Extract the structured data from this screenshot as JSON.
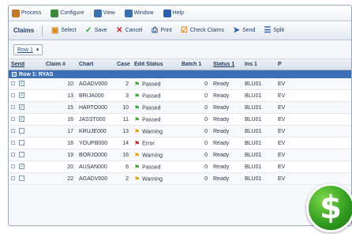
{
  "menubar": {
    "items": [
      {
        "label": "Process",
        "icon": "process-icon",
        "color": "#c47a2a"
      },
      {
        "label": "Configure",
        "icon": "configure-icon",
        "color": "#3d8a3d"
      },
      {
        "label": "View",
        "icon": "view-icon",
        "color": "#3a6fb0"
      },
      {
        "label": "Window",
        "icon": "window-icon",
        "color": "#3a6fb0"
      },
      {
        "label": "Help",
        "icon": "help-icon",
        "color": "#2a5ea8"
      }
    ]
  },
  "toolbar": {
    "title": "Claims",
    "buttons": [
      {
        "label": "Select",
        "icon": "select-icon",
        "glyph": "▣",
        "color": "#d98a1a"
      },
      {
        "label": "Save",
        "icon": "save-icon",
        "glyph": "✓",
        "color": "#2a9a2a"
      },
      {
        "label": "Cancel",
        "icon": "cancel-icon",
        "glyph": "✕",
        "color": "#cc2222"
      },
      {
        "label": "Print",
        "icon": "print-icon",
        "glyph": "⎙",
        "color": "#3a5f8a"
      },
      {
        "label": "Check Claims",
        "icon": "check-claims-icon",
        "glyph": "☑",
        "color": "#d98a1a"
      },
      {
        "label": "Send",
        "icon": "send-icon",
        "glyph": "➤",
        "color": "#2a5ea8"
      },
      {
        "label": "Split",
        "icon": "split-icon",
        "glyph": "☰",
        "color": "#2a5ea8"
      }
    ]
  },
  "filter": {
    "row_select": "Row 1"
  },
  "grid": {
    "columns": [
      "Send",
      "Claim #",
      "Chart",
      "Case",
      "Edit Status",
      "Batch 1",
      "Status 1",
      "Ins 1",
      "P"
    ],
    "group_label": "Row 1: RYAS",
    "rows": [
      {
        "checked": true,
        "claim": "10",
        "chart": "AGADV000",
        "case": "2",
        "flag": "green",
        "status": "Passed",
        "batch": "0",
        "status1": "Ready",
        "ins": "BLU01",
        "extra": "EV"
      },
      {
        "checked": true,
        "claim": "13",
        "chart": "BRIJA000",
        "case": "3",
        "flag": "green",
        "status": "Passed",
        "batch": "0",
        "status1": "Ready",
        "ins": "BLU01",
        "extra": "EV"
      },
      {
        "checked": true,
        "claim": "15",
        "chart": "HARTO000",
        "case": "10",
        "flag": "green",
        "status": "Passed",
        "batch": "0",
        "status1": "Ready",
        "ins": "BLU01",
        "extra": "EV"
      },
      {
        "checked": true,
        "claim": "16",
        "chart": "JASST000",
        "case": "11",
        "flag": "green",
        "status": "Passed",
        "batch": "0",
        "status1": "Ready",
        "ins": "BLU01",
        "extra": "EV"
      },
      {
        "checked": false,
        "claim": "17",
        "chart": "KRUJE000",
        "case": "13",
        "flag": "yellow",
        "status": "Warning",
        "batch": "0",
        "status1": "Ready",
        "ins": "BLU01",
        "extra": "EV"
      },
      {
        "checked": false,
        "claim": "18",
        "chart": "YOUPB000",
        "case": "14",
        "flag": "red",
        "status": "Error",
        "batch": "0",
        "status1": "Ready",
        "ins": "BLU01",
        "extra": "EV"
      },
      {
        "checked": false,
        "claim": "19",
        "chart": "BORJO000",
        "case": "16",
        "flag": "yellow",
        "status": "Warning",
        "batch": "0",
        "status1": "Ready",
        "ins": "BLU01",
        "extra": "EV"
      },
      {
        "checked": true,
        "claim": "20",
        "chart": "AUSAN000",
        "case": "6",
        "flag": "green",
        "status": "Passed",
        "batch": "0",
        "status1": "Ready",
        "ins": "BLU01",
        "extra": "EV"
      },
      {
        "checked": false,
        "claim": "22",
        "chart": "AGADV000",
        "case": "2",
        "flag": "yellow",
        "status": "Warning",
        "batch": "0",
        "status1": "Ready",
        "ins": "BLU01",
        "extra": "EV"
      }
    ]
  },
  "colors": {
    "flag_green": "#3aa52a",
    "flag_yellow": "#e0a400",
    "flag_red": "#cc2222",
    "badge": "#3aa52a"
  },
  "badge": {
    "icon": "dollar-sign-icon",
    "glyph": "$"
  }
}
